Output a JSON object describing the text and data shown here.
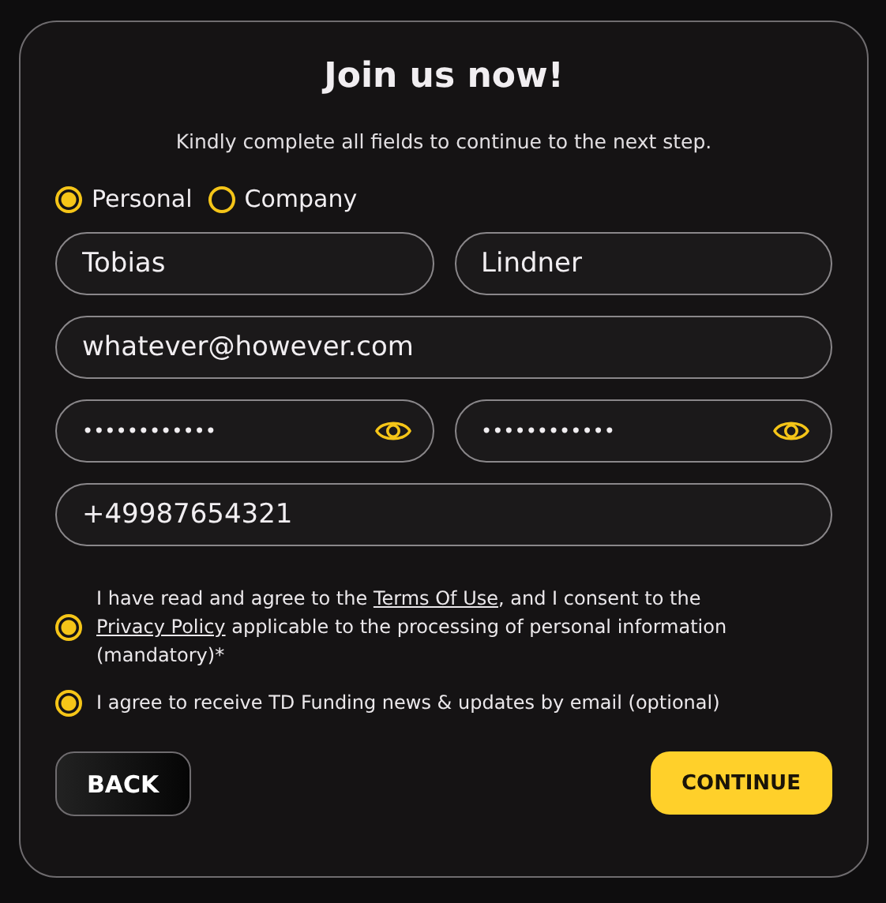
{
  "title": "Join us now!",
  "subtitle": "Kindly complete all fields to continue to the next step.",
  "account_types": [
    {
      "label": "Personal",
      "selected": true
    },
    {
      "label": "Company",
      "selected": false
    }
  ],
  "field_rows": [
    [
      {
        "kind": "text",
        "value": "Tobias"
      },
      {
        "kind": "text",
        "value": "Lindner"
      }
    ],
    [
      {
        "kind": "text",
        "value": "whatever@however.com"
      }
    ],
    [
      {
        "kind": "password",
        "value": "••••••••••••"
      },
      {
        "kind": "password",
        "value": "••••••••••••"
      }
    ],
    [
      {
        "kind": "text",
        "value": "+49987654321"
      }
    ]
  ],
  "consents": [
    {
      "checked": true,
      "parts": [
        {
          "kind": "text",
          "text": "I have read and agree to the "
        },
        {
          "kind": "link",
          "text": "Terms Of Use"
        },
        {
          "kind": "text",
          "text": ", and I consent to the "
        },
        {
          "kind": "link",
          "text": "Privacy Policy"
        },
        {
          "kind": "text",
          "text": " applicable to the processing of personal information (mandatory)*"
        }
      ]
    },
    {
      "checked": true,
      "parts": [
        {
          "kind": "text",
          "text": "I agree to receive TD Funding news & updates by email (optional)"
        }
      ]
    }
  ],
  "buttons": {
    "back": "BACK",
    "continue": "CONTINUE"
  }
}
